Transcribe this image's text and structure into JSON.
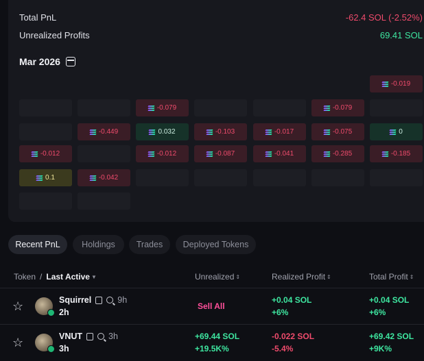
{
  "summary": {
    "total_pnl_label": "Total PnL",
    "total_pnl_value": "-62.4 SOL (-2.52%)",
    "unrealized_label": "Unrealized Profits",
    "unrealized_value": "69.41 SOL"
  },
  "calendar": {
    "month": "Mar 2026",
    "cells": {
      "r0c6": "-0.019",
      "r1c2": "-0.079",
      "r1c5": "-0.079",
      "r2c1": "-0.449",
      "r2c2": "0.032",
      "r2c3": "-0.103",
      "r2c4": "-0.017",
      "r2c5": "-0.075",
      "r2c6": "0",
      "r3c0": "-0.012",
      "r3c2": "-0.012",
      "r3c3": "-0.087",
      "r3c4": "-0.041",
      "r3c5": "-0.285",
      "r3c6": "-0.185",
      "r4c0": "0.1",
      "r4c1": "-0.042"
    }
  },
  "tabs": [
    "Recent PnL",
    "Holdings",
    "Trades",
    "Deployed Tokens"
  ],
  "table": {
    "headers": {
      "token": "Token",
      "slash": "/",
      "last_active": "Last Active",
      "unrealized": "Unrealized",
      "realized": "Realized Profit",
      "total": "Total Profit"
    },
    "rows": [
      {
        "name": "Squirrel",
        "age": "9h",
        "last_active": "2h",
        "unrealized": "Sell All",
        "realized_sol": "+0.04 SOL",
        "realized_pct": "+6%",
        "total_sol": "+0.04 SOL",
        "total_pct": "+6%"
      },
      {
        "name": "VNUT",
        "age": "3h",
        "last_active": "3h",
        "unrealized_sol": "+69.44 SOL",
        "unrealized_pct": "+19.5K%",
        "realized_sol": "-0.022 SOL",
        "realized_pct": "-5.4%",
        "total_sol": "+69.42 SOL",
        "total_pct": "+9K%"
      }
    ]
  },
  "colors": {
    "negative": "#ef4b6c",
    "positive": "#3ee6a0",
    "sell_all": "#ff4f9a"
  }
}
